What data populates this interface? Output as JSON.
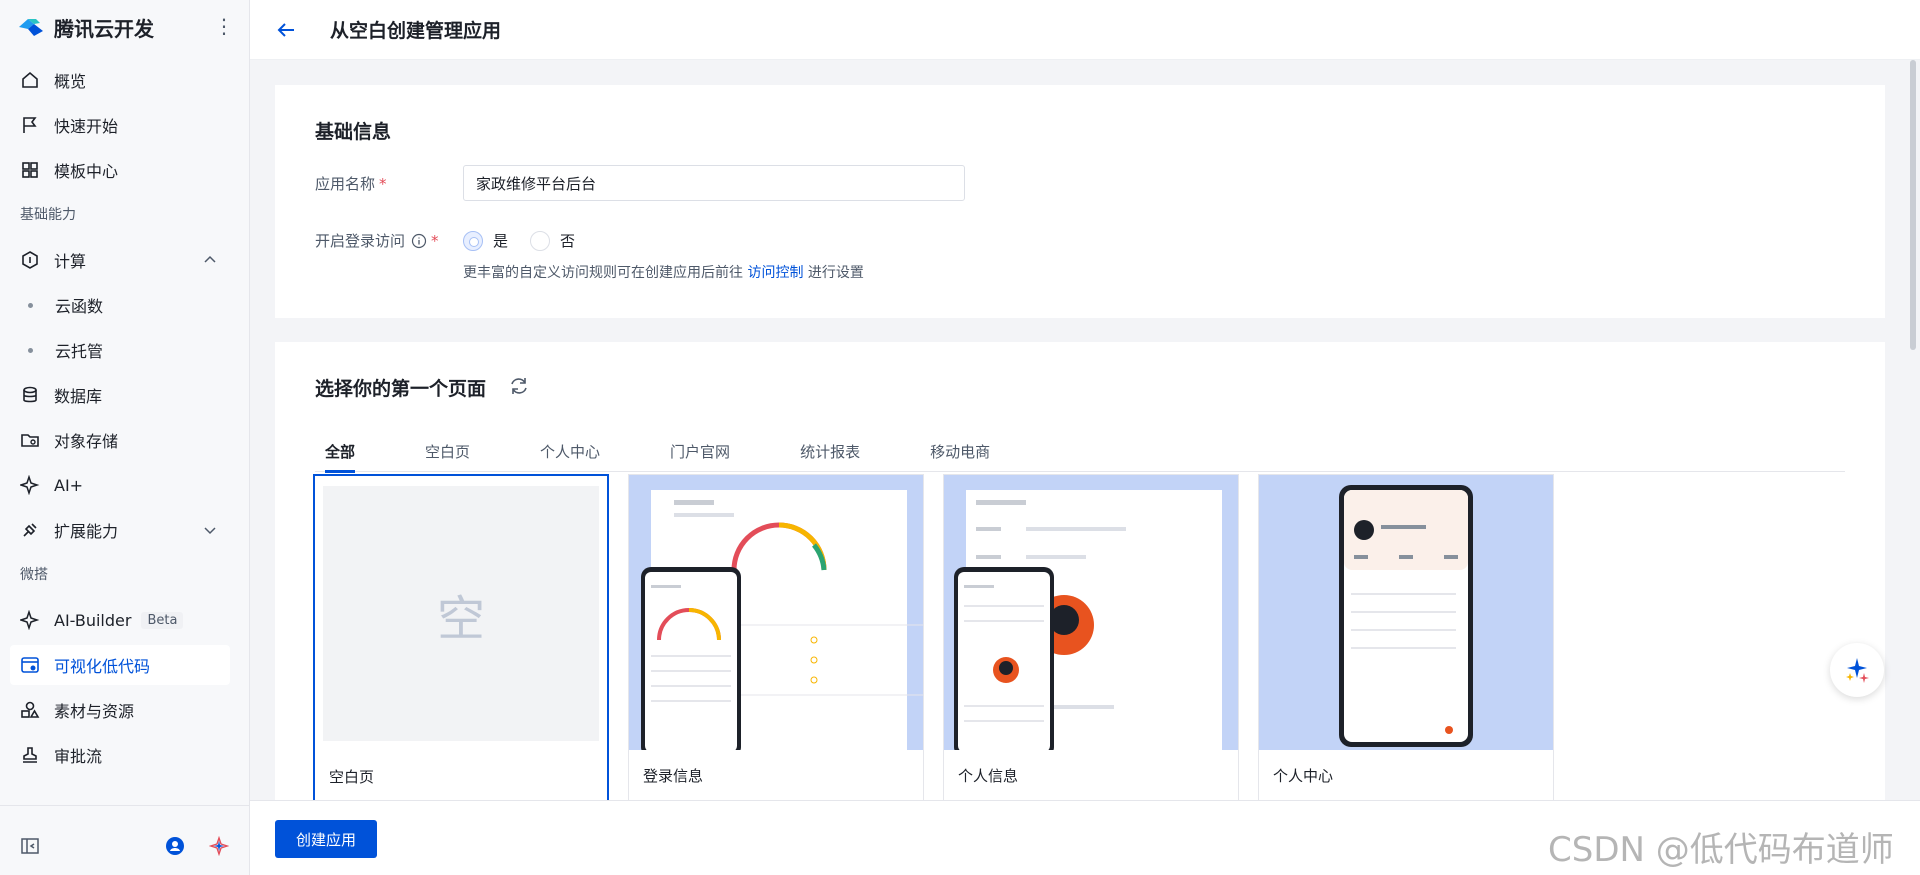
{
  "brand": {
    "title": "腾讯云开发",
    "more": "⋮"
  },
  "nav": {
    "overview": "概览",
    "quickstart": "快速开始",
    "templates": "模板中心",
    "section_basic": "基础能力",
    "compute": "计算",
    "cloud_functions": "云函数",
    "cloud_hosting": "云托管",
    "database": "数据库",
    "storage": "对象存储",
    "ai": "AI+",
    "extensions": "扩展能力",
    "section_weda": "微搭",
    "ai_builder": "AI-Builder",
    "ai_builder_badge": "Beta",
    "lowcode": "可视化低代码",
    "assets": "素材与资源",
    "approval": "审批流"
  },
  "header": {
    "title": "从空白创建管理应用"
  },
  "basic": {
    "title": "基础信息",
    "name_label": "应用名称",
    "name_value": "家政维修平台后台",
    "login_label": "开启登录访问",
    "required_mark": "*",
    "yes": "是",
    "no": "否",
    "hint_prefix": "更丰富的自定义访问规则可在创建应用后前往 ",
    "hint_link": "访问控制",
    "hint_suffix": " 进行设置"
  },
  "pages": {
    "title": "选择你的第一个页面",
    "tabs": [
      "全部",
      "空白页",
      "个人中心",
      "门户官网",
      "统计报表",
      "移动电商"
    ],
    "templates": [
      {
        "name": "空白页",
        "glyph": "空"
      },
      {
        "name": "登录信息"
      },
      {
        "name": "个人信息"
      },
      {
        "name": "个人中心"
      }
    ]
  },
  "footer": {
    "create_label": "创建应用"
  },
  "watermark": "CSDN @低代码布道师",
  "colors": {
    "primary": "#0052d9",
    "thumb_bg": "#c2d3f7",
    "required": "#e34d59"
  }
}
